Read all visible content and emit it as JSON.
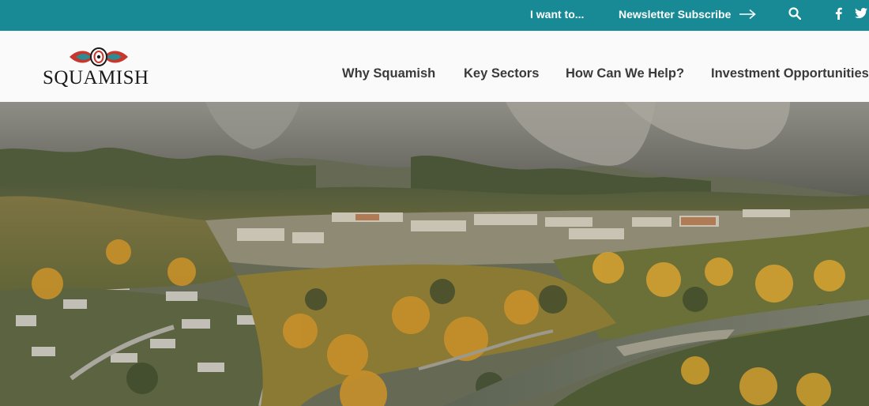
{
  "topbar": {
    "i_want_label": "I want to...",
    "newsletter_label": "Newsletter Subscribe",
    "icons": [
      "arrow-right-icon",
      "search-icon",
      "facebook-icon",
      "twitter-icon"
    ],
    "background_color": "#178a95"
  },
  "header": {
    "logo_text": "SQUAMISH",
    "nav": [
      {
        "label": "Why Squamish"
      },
      {
        "label": "Key Sectors"
      },
      {
        "label": "How Can We Help?"
      },
      {
        "label": "Investment Opportunities"
      }
    ]
  },
  "hero": {
    "scene": "aerial-landscape-photo"
  },
  "colors": {
    "accent_teal": "#178a95",
    "logo_red": "#c8362c",
    "logo_teal": "#2b8c93"
  }
}
